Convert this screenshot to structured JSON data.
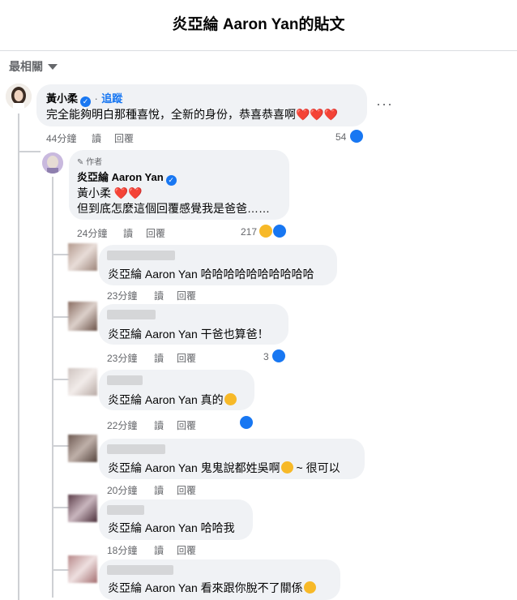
{
  "header": {
    "title": "炎亞綸 Aaron Yan的貼文"
  },
  "sort": {
    "label": "最相關"
  },
  "comment_main": {
    "author": "黃小柔",
    "follow": "追蹤",
    "dot": "·",
    "text": "完全能夠明白那種喜悅，全新的身份，恭喜恭喜啊",
    "hearts": "❤️❤️❤️",
    "time": "44分鐘",
    "reply_label": "讀",
    "respond_label": "回覆",
    "likes": "54"
  },
  "reply_author": {
    "badge": "作者",
    "author": "炎亞綸 Aaron Yan",
    "line1_name": "黃小柔",
    "line1_hearts": "❤️❤️",
    "line2": "但到底怎麼這個回覆感覺我是爸爸……",
    "time": "24分鐘",
    "reply_label": "讀",
    "respond_label": "回覆",
    "likes": "217"
  },
  "replies": [
    {
      "mention": "炎亞綸 Aaron Yan",
      "text": "哈哈哈哈哈哈哈哈哈哈",
      "time": "23分鐘",
      "reply_label": "讀",
      "respond_label": "回覆",
      "likes": ""
    },
    {
      "mention": "炎亞綸 Aaron Yan",
      "text": "干爸也算爸！",
      "time": "23分鐘",
      "reply_label": "讀",
      "respond_label": "回覆",
      "likes": "3"
    },
    {
      "mention": "炎亞綸 Aaron Yan",
      "text": "真的",
      "time": "22分鐘",
      "reply_label": "讀",
      "respond_label": "回覆",
      "likes": ""
    },
    {
      "mention": "炎亞綸 Aaron Yan",
      "text": "鬼鬼說都姓吳啊",
      "text2": "~ 很可以",
      "time": "20分鐘",
      "reply_label": "讀",
      "respond_label": "回覆",
      "likes": ""
    },
    {
      "mention": "炎亞綸 Aaron Yan",
      "text": "哈哈我",
      "time": "18分鐘",
      "reply_label": "讀",
      "respond_label": "回覆",
      "likes": ""
    },
    {
      "mention": "炎亞綸 Aaron Yan",
      "text": "看來跟你脫不了關係",
      "time": "",
      "reply_label": "",
      "respond_label": "",
      "likes": ""
    }
  ],
  "more_label": "···",
  "colors": {
    "accent": "#1877f2",
    "bubble": "#f0f2f5",
    "meta": "#65676b",
    "heart": "#e41e3f"
  }
}
